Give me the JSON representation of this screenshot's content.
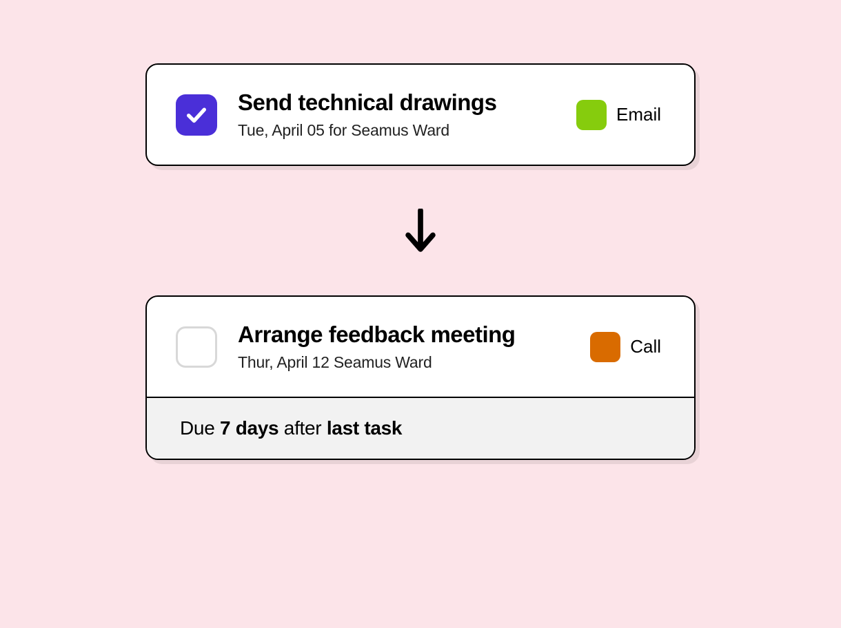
{
  "tasks": [
    {
      "title": "Send technical drawings",
      "subtitle": "Tue, April 05 for Seamus Ward",
      "checked": true,
      "tag": {
        "label": "Email",
        "color": "#86cc0d"
      }
    },
    {
      "title": "Arrange feedback meeting",
      "subtitle": "Thur, April 12 Seamus Ward",
      "checked": false,
      "tag": {
        "label": "Call",
        "color": "#d96b00"
      }
    }
  ],
  "due": {
    "prefix": "Due ",
    "days": "7 days",
    "mid": " after ",
    "ref": "last task"
  }
}
